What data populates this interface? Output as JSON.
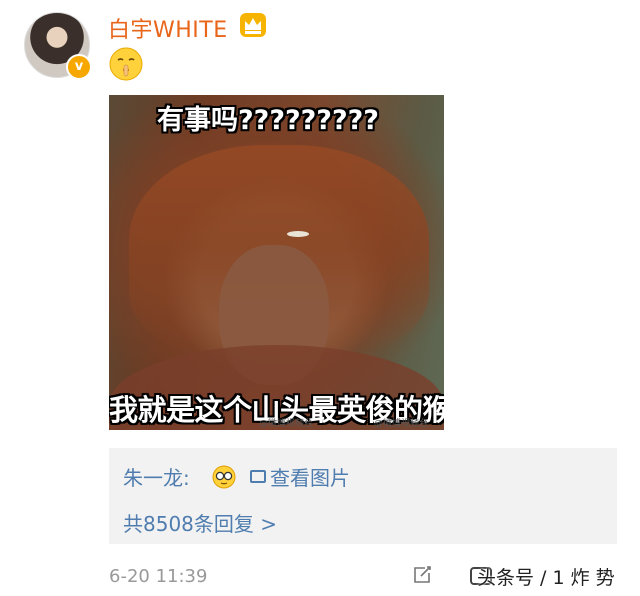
{
  "post": {
    "username": "白宇WHITE",
    "icons": {
      "avatar": "avatar",
      "verified": "verified-v-badge",
      "crown": "crown-icon",
      "emoji": "shush-emoji"
    },
    "verified_glyph": "v",
    "meme": {
      "top_text": "有事吗?????????",
      "bottom_text": "我就是这个山头最英俊的猴",
      "watermark_1": "@微博视频台",
      "watermark_2": "@微博视频台"
    }
  },
  "comment": {
    "commenter": "朱一龙:",
    "emoji": "glasses-face-emoji",
    "view_image_label": "查看图片",
    "replies_label": "共8508条回复 >"
  },
  "footer": {
    "timestamp": "6-20 11:39",
    "watermark": "头条号 / 1 炸 势"
  },
  "colors": {
    "username": "#e8651a",
    "link": "#507daf",
    "timestamp": "#999999",
    "comment_bg": "#f2f2f2"
  }
}
